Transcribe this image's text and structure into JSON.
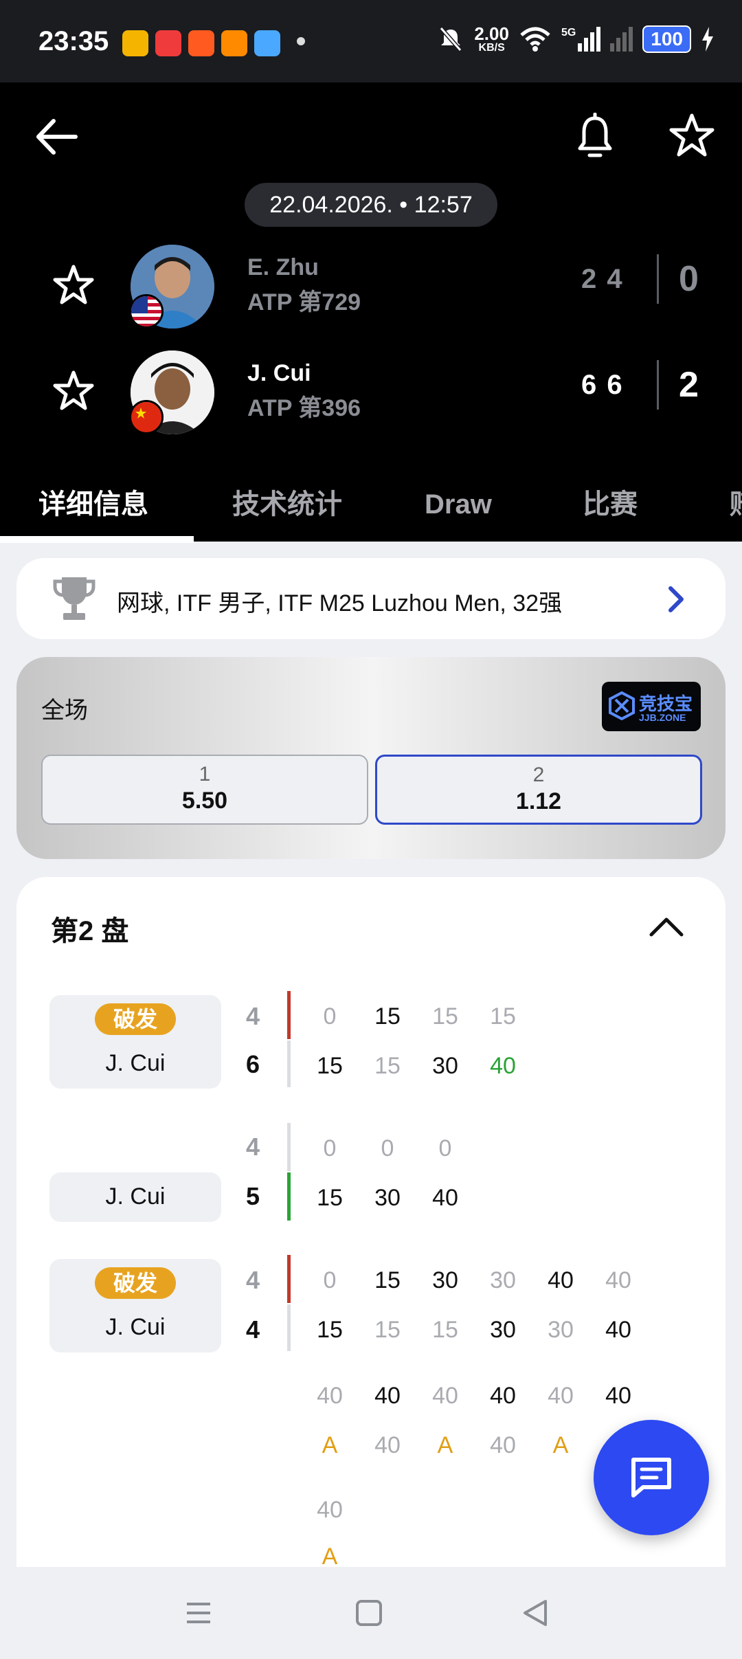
{
  "status_bar": {
    "time": "23:35",
    "net_speed_value": "2.00",
    "net_speed_unit": "KB/S",
    "network_type": "5G",
    "battery": "100"
  },
  "match": {
    "datetime": "22.04.2026. • 12:57",
    "players": [
      {
        "name": "E. Zhu",
        "rank": "ATP 第729",
        "set_scores": "2 4",
        "sets_won": "0",
        "flag": "USA"
      },
      {
        "name": "J. Cui",
        "rank": "ATP 第396",
        "set_scores": "6 6",
        "sets_won": "2",
        "flag": "China"
      }
    ]
  },
  "tabs": [
    "详细信息",
    "技术统计",
    "Draw",
    "比赛",
    "赔"
  ],
  "tournament": {
    "text": "网球, ITF 男子, ITF M25 Luzhou Men, 32强"
  },
  "odds": {
    "label": "全场",
    "bookmaker_cn": "竞技宝",
    "bookmaker_en": "JJB.ZONE",
    "options": [
      {
        "key": "1",
        "value": "5.50"
      },
      {
        "key": "2",
        "value": "1.12"
      }
    ]
  },
  "set_detail": {
    "title": "第2 盘",
    "games": [
      {
        "badge": "破发",
        "server": "J. Cui",
        "score_top": "4",
        "score_bottom": "6",
        "top_points": [
          "0",
          "15",
          "15",
          "15"
        ],
        "bottom_points": [
          "15",
          "15",
          "30",
          "40"
        ]
      },
      {
        "badge": "",
        "server": "J. Cui",
        "score_top": "4",
        "score_bottom": "5",
        "top_points": [
          "0",
          "0",
          "0"
        ],
        "bottom_points": [
          "15",
          "30",
          "40"
        ]
      },
      {
        "badge": "破发",
        "server": "J. Cui",
        "score_top": "4",
        "score_bottom": "4",
        "top_points": [
          "0",
          "15",
          "30",
          "30",
          "40",
          "40"
        ],
        "bottom_points": [
          "15",
          "15",
          "15",
          "30",
          "30",
          "40"
        ],
        "deuce_top": [
          "40",
          "40",
          "40",
          "40",
          "40",
          "40"
        ],
        "deuce_bottom": [
          "A",
          "40",
          "A",
          "40",
          "A",
          "40"
        ],
        "deuce2_top": [
          "40"
        ],
        "deuce2_bottom": [
          "A"
        ]
      }
    ]
  },
  "colors": {
    "header_bg": "#000000",
    "accent_blue": "#2d49f2",
    "break_badge": "#e7a320",
    "win_point_green": "#2aa336",
    "advantage_orange": "#e19e14",
    "bar_red": "#c0392b",
    "bar_green": "#2aa336"
  }
}
